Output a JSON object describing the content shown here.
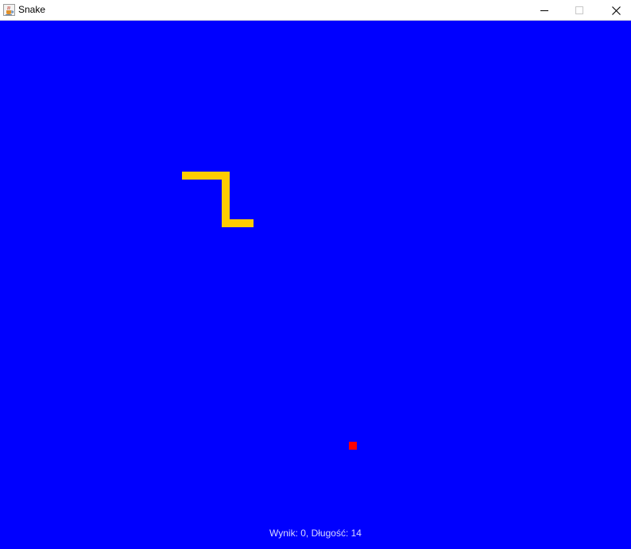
{
  "window": {
    "title": "Snake",
    "app_icon": "java-cup-icon"
  },
  "window_controls": {
    "minimize_icon": "minimize-icon",
    "maximize_icon": "maximize-icon",
    "close_icon": "close-icon"
  },
  "game": {
    "status_text": "Wynik: 0, Długość: 14",
    "score": 0,
    "length": 14,
    "colors": {
      "background": "#0000ff",
      "snake": "#ffcc00",
      "food": "#ff0000",
      "status_text": "#d9d9ff"
    }
  }
}
